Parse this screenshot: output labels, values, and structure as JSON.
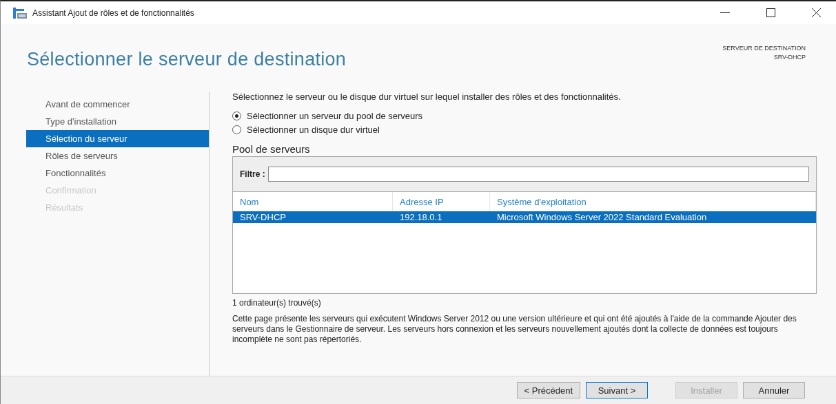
{
  "window": {
    "title": "Assistant Ajout de rôles et de fonctionnalités"
  },
  "header": {
    "title": "Sélectionner le serveur de destination",
    "destination_label": "SERVEUR DE DESTINATION",
    "destination_server": "SRV-DHCP"
  },
  "sidebar": {
    "items": [
      {
        "label": "Avant de commencer",
        "selected": false,
        "disabled": false
      },
      {
        "label": "Type d'installation",
        "selected": false,
        "disabled": false
      },
      {
        "label": "Sélection du serveur",
        "selected": true,
        "disabled": false
      },
      {
        "label": "Rôles de serveurs",
        "selected": false,
        "disabled": false
      },
      {
        "label": "Fonctionnalités",
        "selected": false,
        "disabled": false
      },
      {
        "label": "Confirmation",
        "selected": false,
        "disabled": true
      },
      {
        "label": "Résultats",
        "selected": false,
        "disabled": true
      }
    ]
  },
  "intro": "Sélectionnez le serveur ou le disque dur virtuel sur lequel installer des rôles et des fonctionnalités.",
  "options": [
    {
      "label": "Sélectionner un serveur du pool de serveurs",
      "selected": true
    },
    {
      "label": "Sélectionner un disque dur virtuel",
      "selected": false
    }
  ],
  "pool": {
    "title": "Pool de serveurs",
    "filter_label": "Filtre :",
    "columns": [
      "Nom",
      "Adresse IP",
      "Système d'exploitation"
    ],
    "rows": [
      {
        "cells": [
          "SRV-DHCP",
          "192.18.0.1",
          "Microsoft Windows Server 2022 Standard Evaluation"
        ],
        "selected": true
      }
    ],
    "count": "1 ordinateur(s) trouvé(s)"
  },
  "note": "Cette page présente les serveurs qui exécutent Windows Server 2012 ou une version ultérieure et qui ont été ajoutés à l'aide de la commande Ajouter des serveurs dans le Gestionnaire de serveur. Les serveurs hors connexion et les serveurs nouvellement ajoutés dont la collecte de données est toujours incomplète ne sont pas répertoriés.",
  "buttons": [
    {
      "label": "< Précédent",
      "disabled": false,
      "focused": false
    },
    {
      "label": "Suivant >",
      "disabled": false,
      "focused": true
    },
    {
      "label": "Installer",
      "disabled": true,
      "focused": false
    },
    {
      "label": "Annuler",
      "disabled": false,
      "focused": false
    }
  ]
}
